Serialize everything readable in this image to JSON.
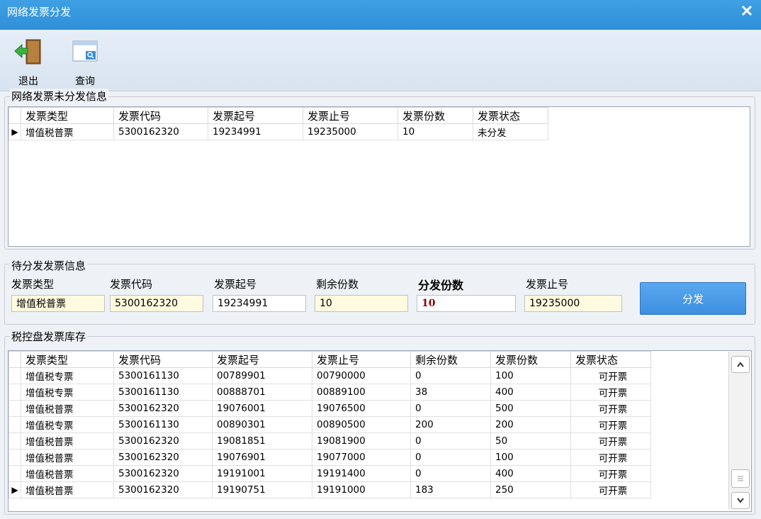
{
  "window": {
    "title": "网络发票分发"
  },
  "toolbar": {
    "exit_label": "退出",
    "query_label": "查询"
  },
  "undistributed": {
    "title": "网络发票未分发信息",
    "columns": [
      "发票类型",
      "发票代码",
      "发票起号",
      "发票止号",
      "发票份数",
      "发票状态"
    ],
    "rows": [
      [
        "增值税普票",
        "5300162320",
        "19234991",
        "19235000",
        "10",
        "未分发"
      ]
    ]
  },
  "pending": {
    "title": "待分发发票信息",
    "labels": {
      "type": "发票类型",
      "code": "发票代码",
      "start": "发票起号",
      "remaining": "剩余份数",
      "dist_count": "分发份数",
      "end": "发票止号"
    },
    "values": {
      "type": "增值税普票",
      "code": "5300162320",
      "start": "19234991",
      "remaining": "10",
      "dist_count": "10",
      "end": "19235000"
    },
    "distribute_label": "分发"
  },
  "inventory": {
    "title": "税控盘发票库存",
    "columns": [
      "发票类型",
      "发票代码",
      "发票起号",
      "发票止号",
      "剩余份数",
      "发票份数",
      "发票状态"
    ],
    "rows": [
      [
        "增值税专票",
        "5300161130",
        "00789901",
        "00790000",
        "0",
        "100",
        "可开票"
      ],
      [
        "增值税专票",
        "5300161130",
        "00888701",
        "00889100",
        "38",
        "400",
        "可开票"
      ],
      [
        "增值税普票",
        "5300162320",
        "19076001",
        "19076500",
        "0",
        "500",
        "可开票"
      ],
      [
        "增值税专票",
        "5300161130",
        "00890301",
        "00890500",
        "200",
        "200",
        "可开票"
      ],
      [
        "增值税普票",
        "5300162320",
        "19081851",
        "19081900",
        "0",
        "50",
        "可开票"
      ],
      [
        "增值税普票",
        "5300162320",
        "19076901",
        "19077000",
        "0",
        "100",
        "可开票"
      ],
      [
        "增值税普票",
        "5300162320",
        "19191001",
        "19191400",
        "0",
        "400",
        "可开票"
      ],
      [
        "增值税普票",
        "5300162320",
        "19190751",
        "19191000",
        "183",
        "250",
        "可开票"
      ]
    ]
  },
  "icons": [
    "close-icon",
    "exit-door-icon",
    "query-window-icon",
    "row-pointer-icon",
    "scroll-up-icon",
    "scroll-thumb-icon",
    "scroll-down-icon"
  ]
}
